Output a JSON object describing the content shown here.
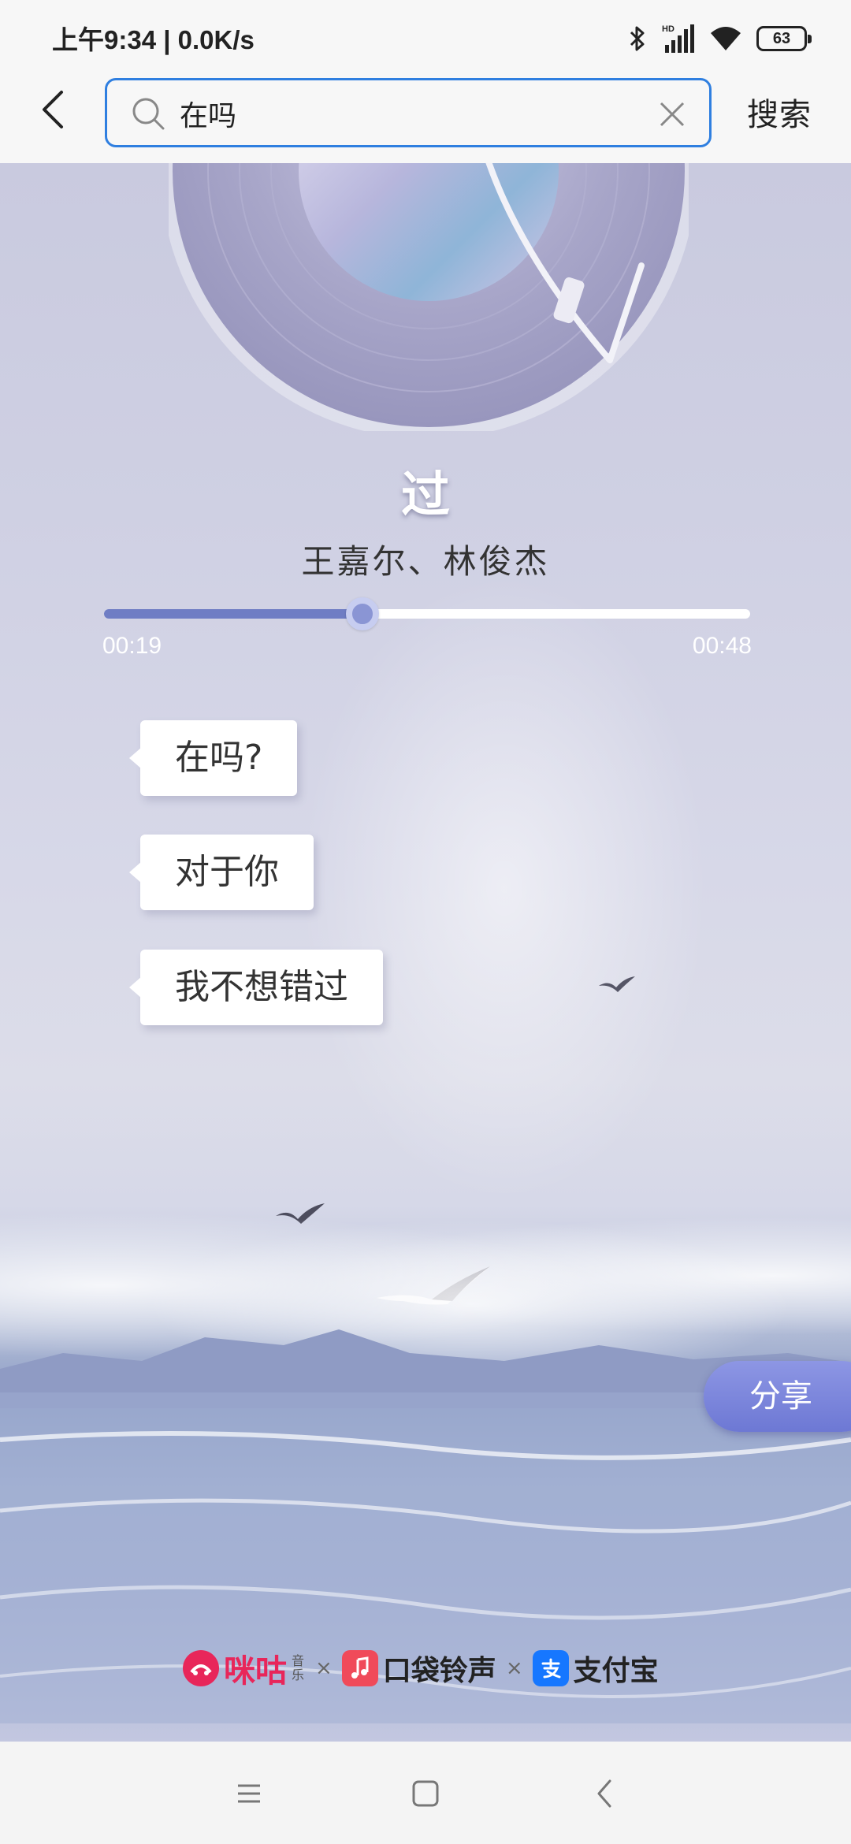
{
  "status_bar": {
    "time_and_speed": "上午9:34 | 0.0K/s",
    "battery_level": "63",
    "icons": [
      "bluetooth-icon",
      "hd-signal-icon",
      "wifi-icon",
      "battery-icon"
    ]
  },
  "search": {
    "query": "在吗",
    "submit_label": "搜索"
  },
  "song": {
    "title": "过",
    "artist": "王嘉尔、林俊杰",
    "current_time": "00:19",
    "total_time": "00:48",
    "progress_fraction": 0.4
  },
  "chat_bubbles": [
    "在吗?",
    "对于你",
    "我不想错过"
  ],
  "share_label": "分享",
  "brands": {
    "migu": "咪咕",
    "migu_sub": "音乐",
    "separator": "×",
    "pocket": "口袋铃声",
    "alipay": "支付宝"
  },
  "colors": {
    "search_border": "#2f7fe0",
    "progress_fill": "#6f7dc4",
    "share_button": "#7b85dc",
    "migu_red": "#e8265a",
    "pocket_red": "#f04a5a",
    "alipay_blue": "#1677ff"
  },
  "nav_bar": {
    "icons": [
      "menu-icon",
      "home-icon",
      "back-icon"
    ]
  }
}
